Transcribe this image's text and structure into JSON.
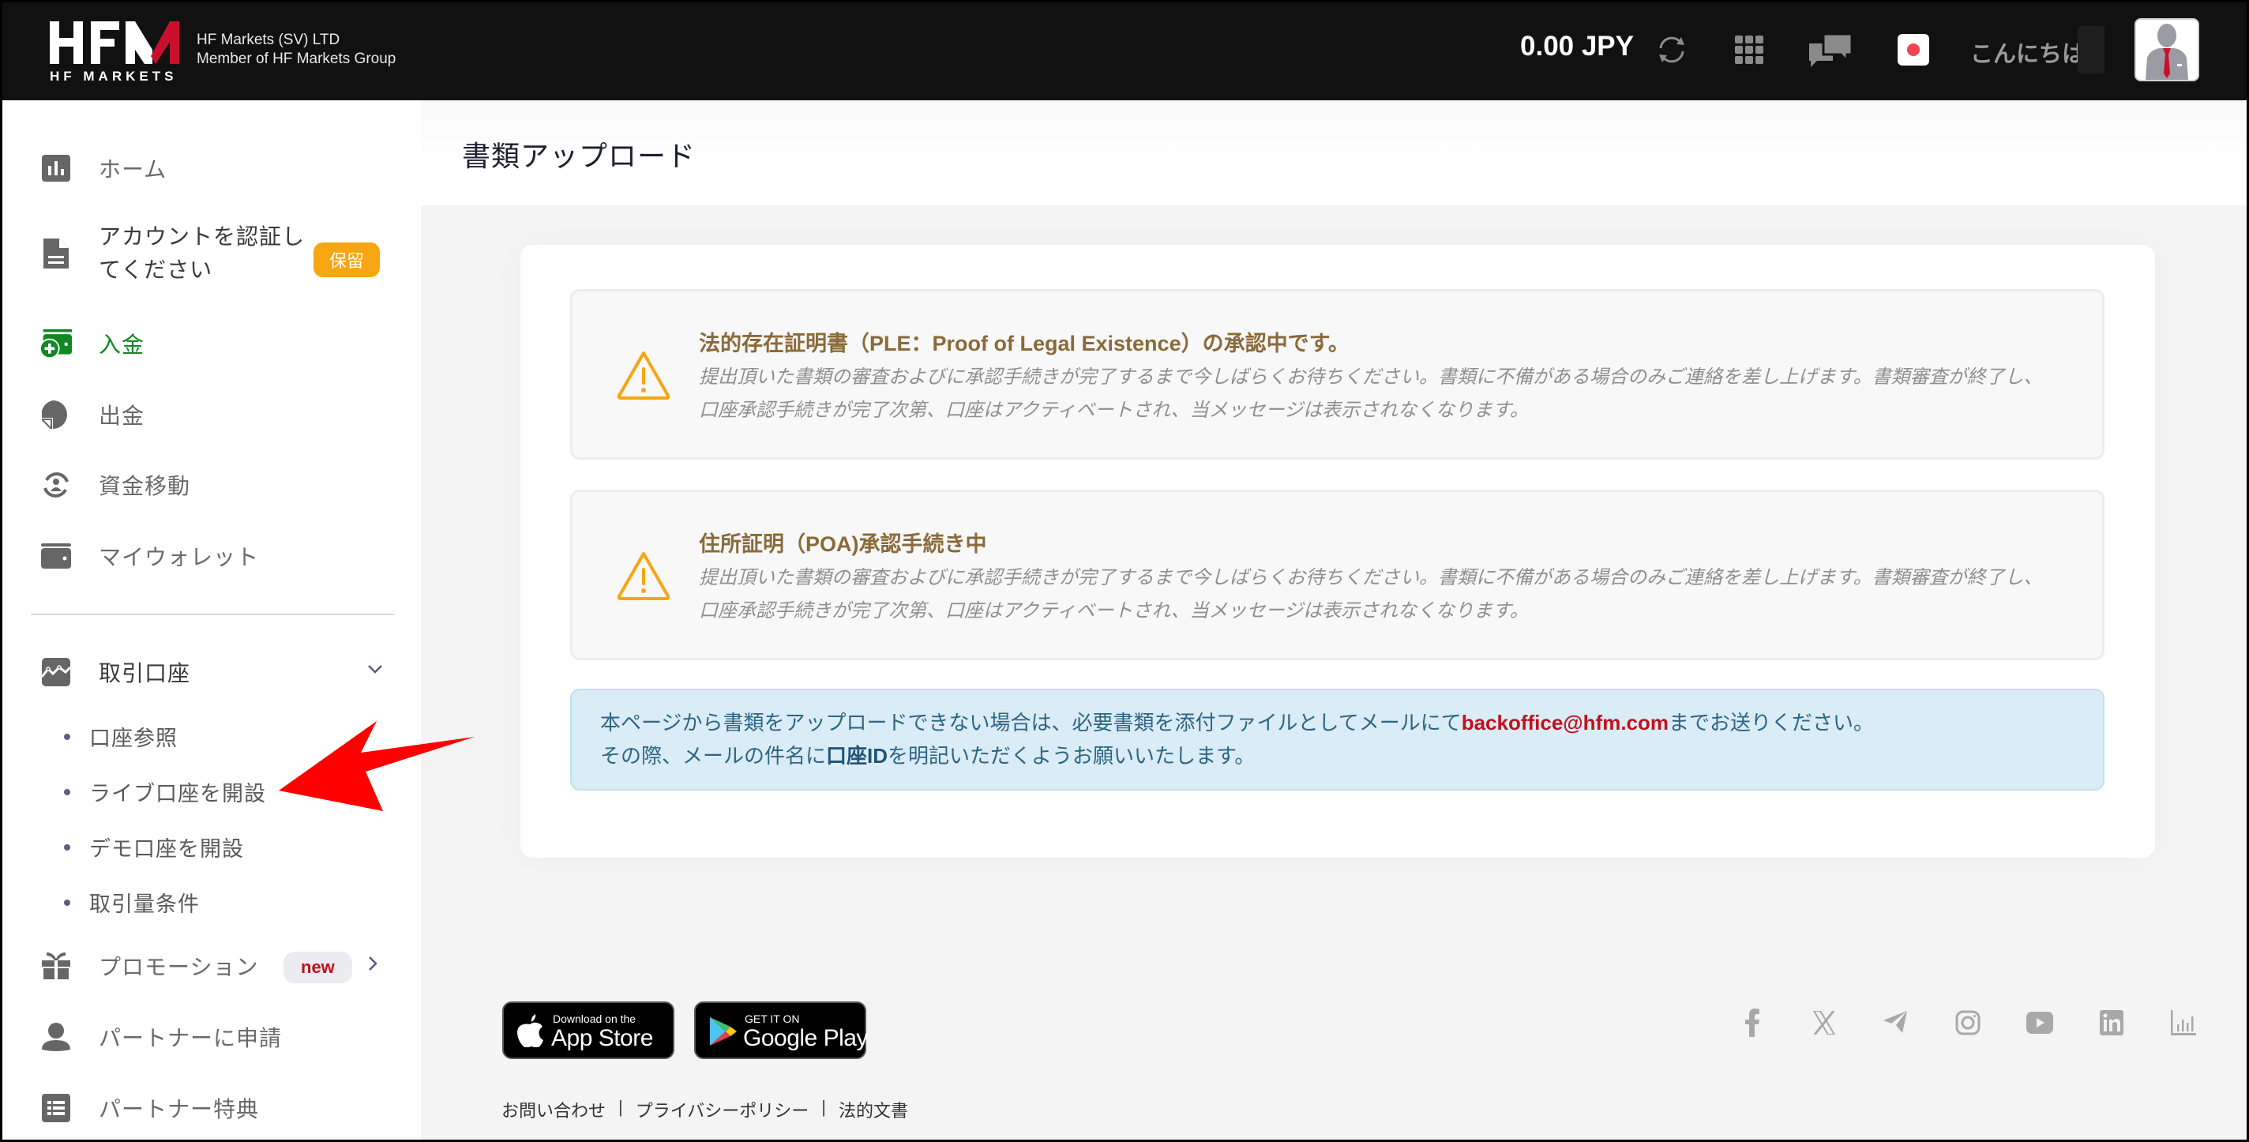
{
  "header": {
    "logo_text": "HFM",
    "logo_subtext": "HF MARKETS",
    "company_line1": "HF Markets (SV) LTD",
    "company_line2": "Member of HF Markets Group",
    "balance": "0.00 JPY",
    "greeting": "こんにちは",
    "icons": [
      "refresh-icon",
      "apps-grid-icon",
      "chat-icon",
      "japan-flag-icon",
      "avatar"
    ]
  },
  "sidebar": {
    "items": [
      {
        "label": "ホーム",
        "icon": "bar-chart-icon"
      },
      {
        "label": "アカウントを認証してください",
        "icon": "document-icon",
        "badge": "保留"
      },
      {
        "label": "入金",
        "icon": "deposit-wallet-icon",
        "active": true
      },
      {
        "label": "出金",
        "icon": "withdraw-icon"
      },
      {
        "label": "資金移動",
        "icon": "transfer-icon"
      },
      {
        "label": "マイウォレット",
        "icon": "wallet-icon"
      }
    ],
    "trading": {
      "label": "取引口座",
      "icon": "chart-area-icon",
      "expanded": true,
      "sub_items": [
        "口座参照",
        "ライブ口座を開設",
        "デモ口座を開設",
        "取引量条件"
      ]
    },
    "bottom_items": [
      {
        "label": "プロモーション",
        "icon": "gift-icon",
        "badge": "new"
      },
      {
        "label": "パートナーに申請",
        "icon": "person-icon"
      },
      {
        "label": "パートナー特典",
        "icon": "list-icon"
      }
    ]
  },
  "page": {
    "title": "書類アップロード",
    "alerts": [
      {
        "title": "法的存在証明書（PLE：Proof of Legal Existence）の承認中です。",
        "body": "提出頂いた書類の審査およびに承認手続きが完了するまで今しばらくお待ちください。書類に不備がある場合のみご連絡を差し上げます。書類審査が終了し、口座承認手続きが完了次第、口座はアクティベートされ、当メッセージは表示されなくなります。"
      },
      {
        "title": "住所証明（POA)承認手続き中",
        "body": "提出頂いた書類の審査およびに承認手続きが完了するまで今しばらくお待ちください。書類に不備がある場合のみご連絡を差し上げます。書類審査が終了し、口座承認手続きが完了次第、口座はアクティベートされ、当メッセージは表示されなくなります。"
      }
    ],
    "info": {
      "line1_prefix": "本ページから書類をアップロードできない場合は、必要書類を添付ファイルとしてメールにて",
      "email": "backoffice@hfm.com",
      "line1_suffix": "までお送りください。",
      "line2_prefix": "その際、メールの件名に",
      "line2_bold": "口座ID",
      "line2_suffix": "を明記いただくようお願いいたします。"
    }
  },
  "footer": {
    "appstore_small": "Download on the",
    "appstore_big": "App Store",
    "googleplay_small": "GET IT ON",
    "googleplay_big": "Google Play",
    "links": [
      "お問い合わせ",
      "プライバシーポリシー",
      "法的文書"
    ],
    "separator": "|",
    "socials": [
      "facebook-icon",
      "x-icon",
      "telegram-icon",
      "instagram-icon",
      "youtube-icon",
      "linkedin-icon",
      "analytics-icon"
    ]
  },
  "colors": {
    "header_bg": "#111111",
    "active_green": "#118822",
    "pending_badge": "#f5a612",
    "alert_title": "#8a6a3a",
    "warning": "#f5a612",
    "info_bg": "#daecf6",
    "email_red": "#c4101c",
    "brand_red": "#c8102e"
  }
}
